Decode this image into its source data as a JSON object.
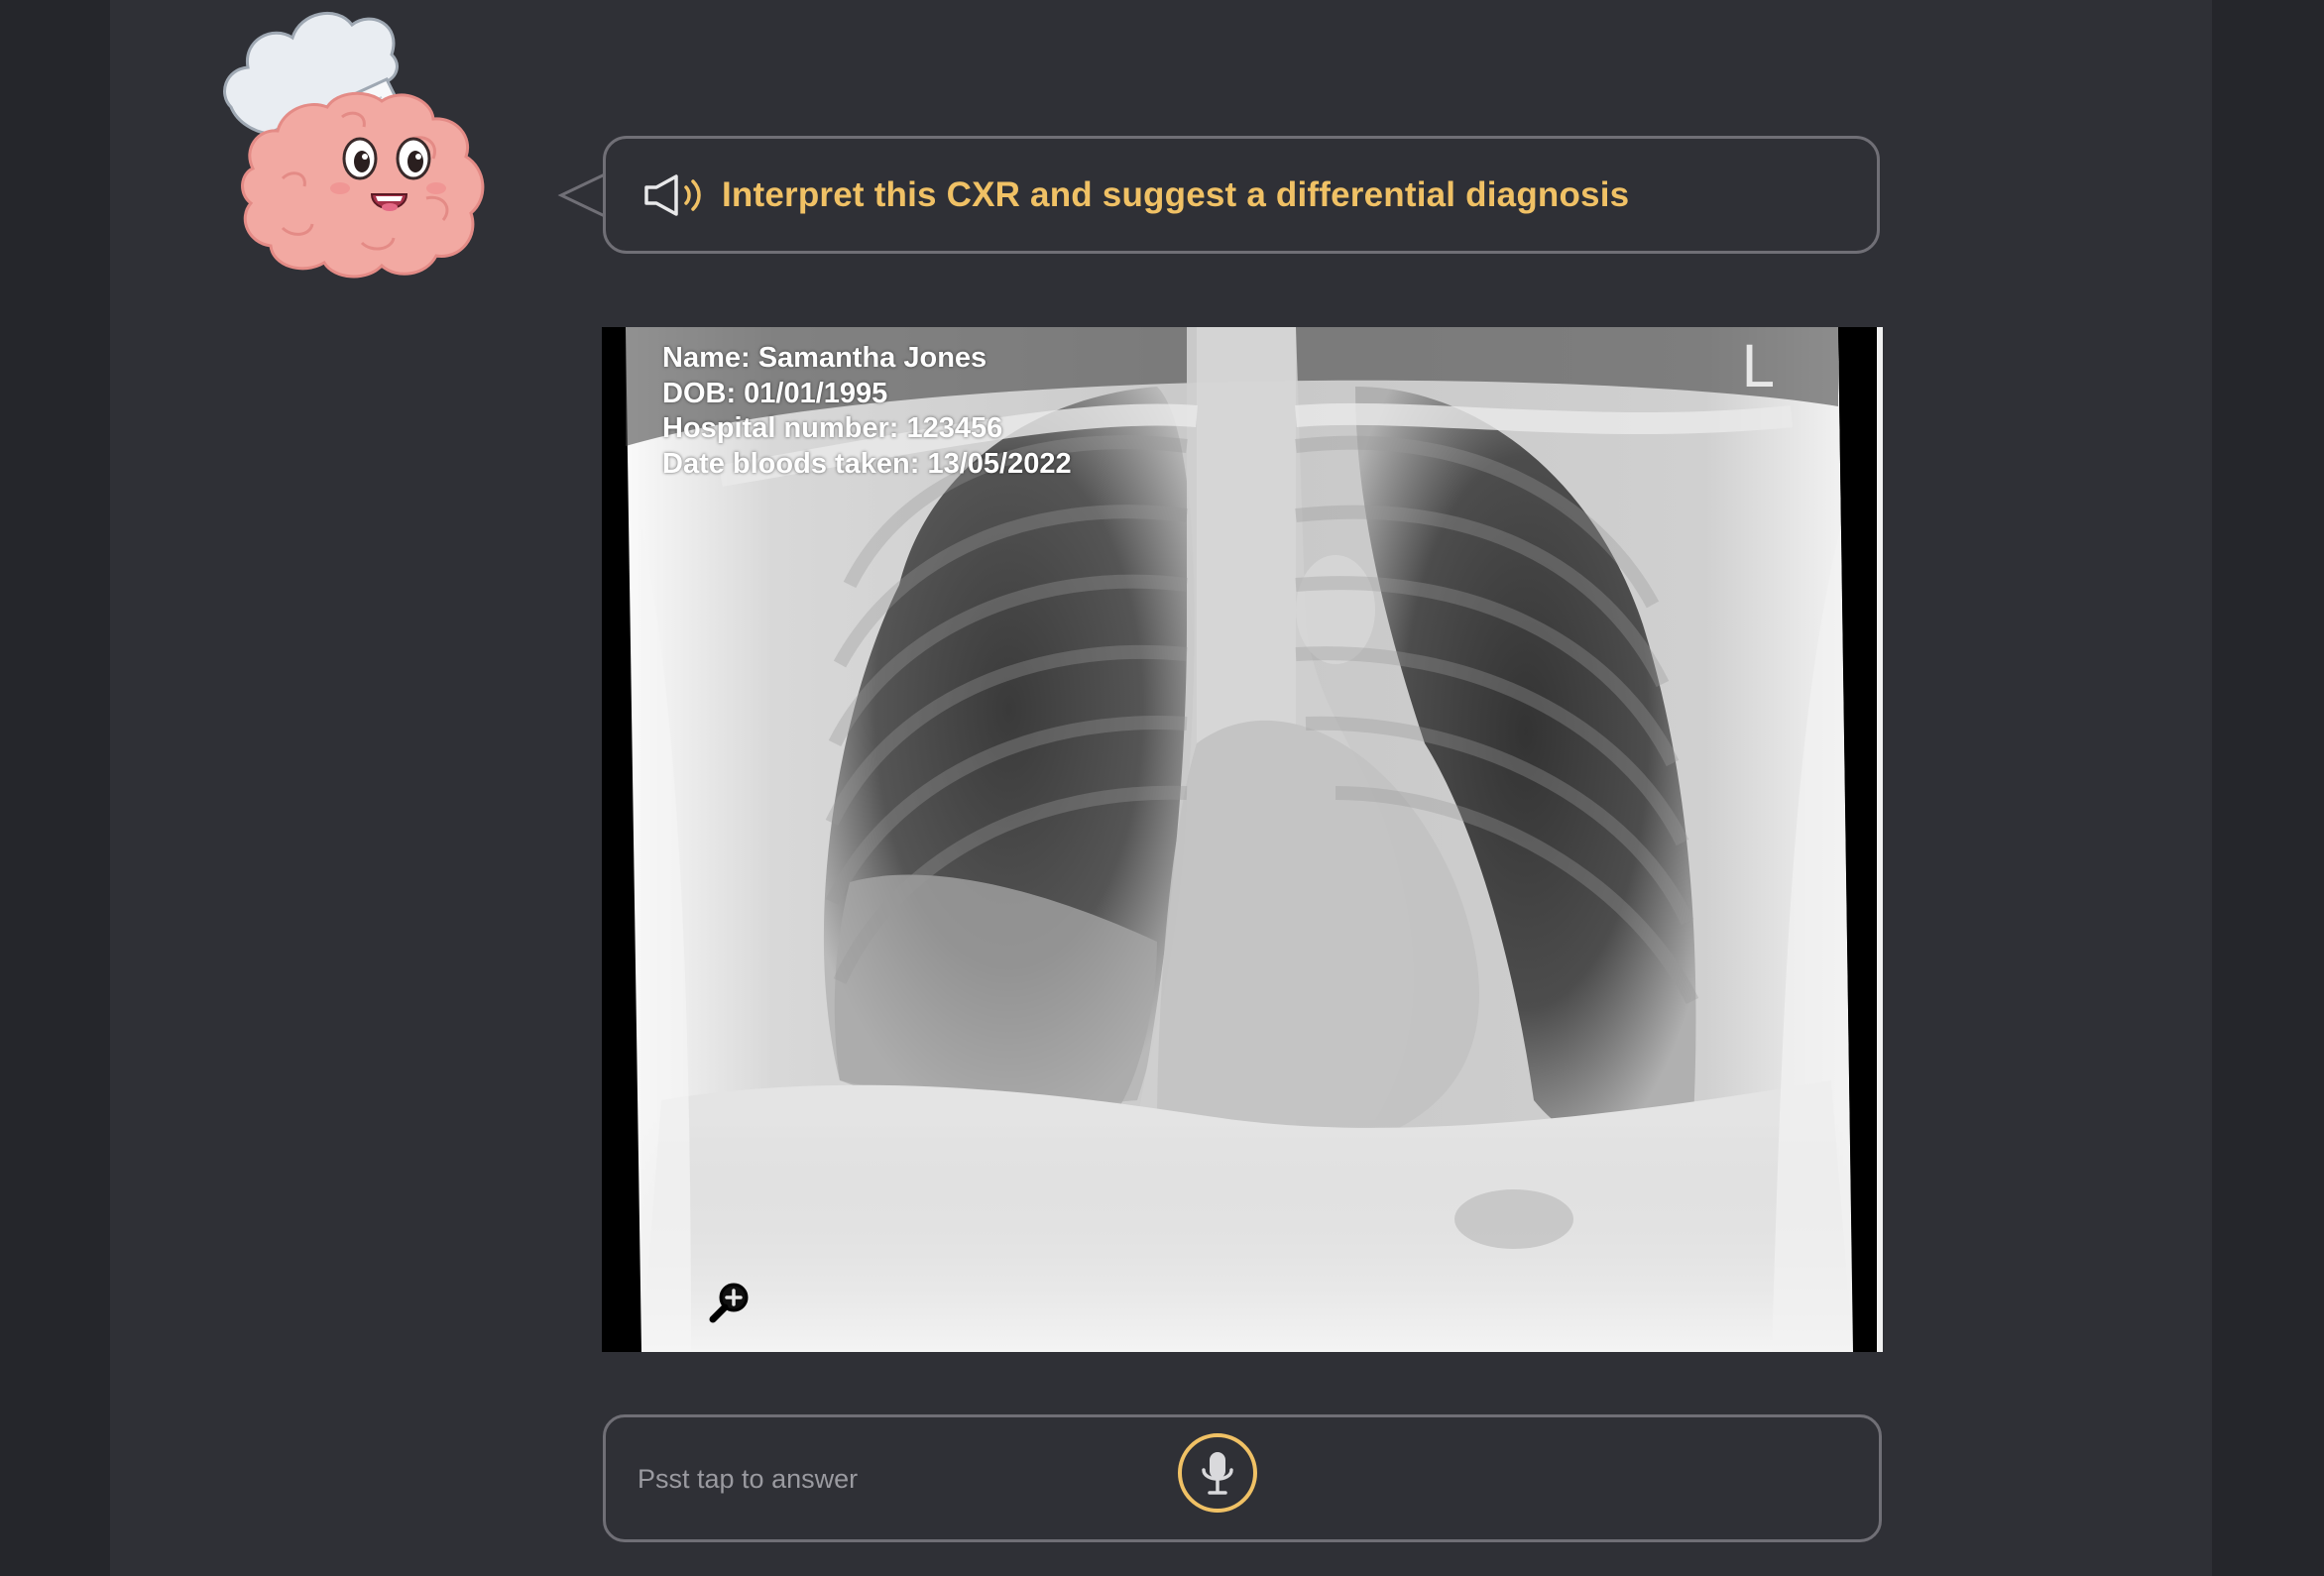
{
  "prompt": {
    "text": "Interpret this CXR and suggest a differential diagnosis",
    "icon": "speaker-icon",
    "color": "#f0c165"
  },
  "mascot": {
    "icon": "brain-chef-mascot"
  },
  "xray": {
    "name_line": "Name: Samantha Jones",
    "dob_line": "DOB: 01/01/1995",
    "hospital_line": "Hospital number: 123456",
    "date_line": "Date bloods taken: 13/05/2022",
    "side_marker": "L",
    "zoom_icon": "zoom-in-icon"
  },
  "answer": {
    "placeholder": "Psst tap to answer",
    "mic_icon": "microphone-icon",
    "accent": "#f0c165"
  },
  "colors": {
    "background": "#25262b",
    "panel": "#2f3036",
    "border": "#706f76"
  }
}
